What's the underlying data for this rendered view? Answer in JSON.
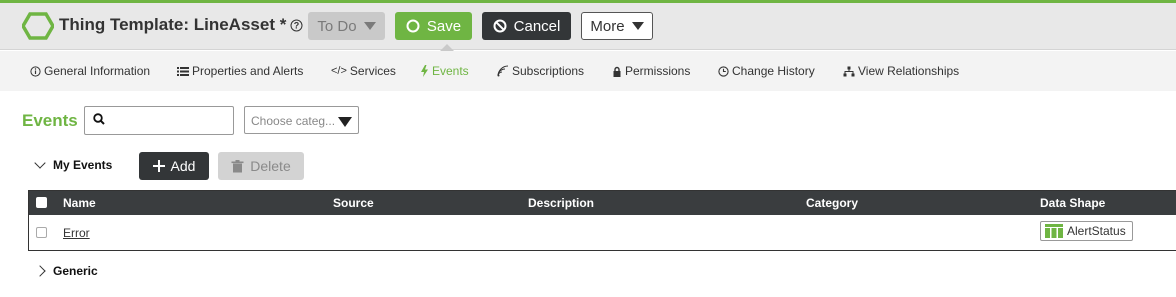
{
  "header": {
    "title": "Thing Template: LineAsset *",
    "help_icon": "question-circle-icon",
    "todo_label": "To Do",
    "save_label": "Save",
    "cancel_label": "Cancel",
    "more_label": "More"
  },
  "tabs": [
    {
      "label": "General Information",
      "icon": "info-circle-icon"
    },
    {
      "label": "Properties and Alerts",
      "icon": "list-icon"
    },
    {
      "label": "Services",
      "icon": "code-icon"
    },
    {
      "label": "Events",
      "icon": "lightning-icon",
      "active": true
    },
    {
      "label": "Subscriptions",
      "icon": "signal-icon"
    },
    {
      "label": "Permissions",
      "icon": "lock-icon"
    },
    {
      "label": "Change History",
      "icon": "clock-icon"
    },
    {
      "label": "View Relationships",
      "icon": "hierarchy-icon"
    }
  ],
  "events": {
    "heading": "Events",
    "search_value": "",
    "category_placeholder": "Choose categ..."
  },
  "my_events": {
    "label": "My Events",
    "add_label": "Add",
    "delete_label": "Delete"
  },
  "table": {
    "columns": [
      "Name",
      "Source",
      "Description",
      "Category",
      "Data Shape"
    ],
    "rows": [
      {
        "name": "Error",
        "source": "",
        "description": "",
        "category": "",
        "data_shape": "AlertStatus"
      }
    ]
  },
  "generic": {
    "label": "Generic"
  },
  "colors": {
    "accent": "#6fb543",
    "dark": "#333638"
  }
}
